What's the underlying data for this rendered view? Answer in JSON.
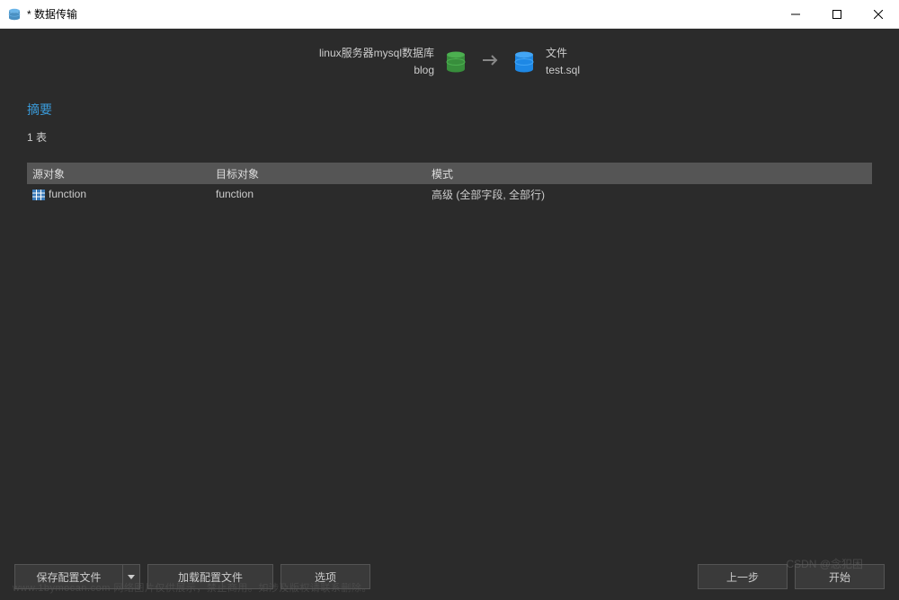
{
  "window": {
    "title": "* 数据传输"
  },
  "transfer": {
    "source_line1": "linux服务器mysql数据库",
    "source_line2": "blog",
    "dest_line1": "文件",
    "dest_line2": "test.sql"
  },
  "summary": {
    "title": "摘要",
    "count": "1 表"
  },
  "table": {
    "headers": {
      "source": "源对象",
      "target": "目标对象",
      "mode": "模式"
    },
    "rows": [
      {
        "source": "function",
        "target": "function",
        "mode": "高级 (全部字段, 全部行)"
      }
    ]
  },
  "footer": {
    "save_profile": "保存配置文件",
    "load_profile": "加载配置文件",
    "options": "选项",
    "back": "上一步",
    "start": "开始"
  },
  "watermark": {
    "left": "www.1bymocan.com 网络图片仅供展示，禁止商用。如涉及版权请联系删除。",
    "right": "CSDN @念犯困"
  }
}
